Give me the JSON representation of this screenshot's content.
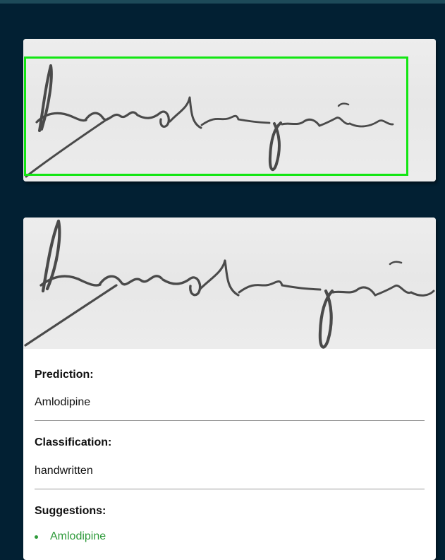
{
  "colors": {
    "page_background": "#022033",
    "detection_box": "#13e613",
    "suggestion": "#2e9a3a"
  },
  "result": {
    "prediction_label": "Prediction:",
    "prediction_value": "Amlodipine",
    "classification_label": "Classification:",
    "classification_value": "handwritten",
    "suggestions_label": "Suggestions:",
    "suggestions": [
      "Amlodipine"
    ]
  },
  "images": {
    "detected_crop": "handwritten signature-like text image",
    "processed_crop": "handwritten signature-like text image"
  }
}
